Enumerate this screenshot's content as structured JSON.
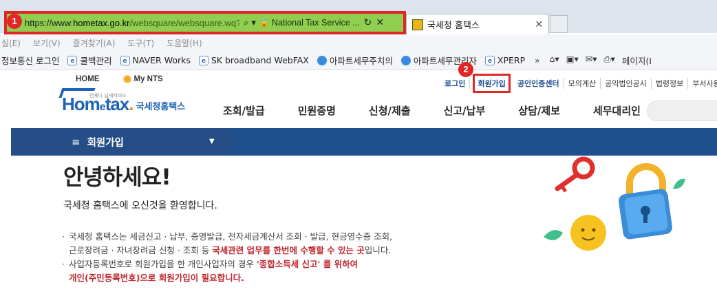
{
  "browser": {
    "badge1": "1",
    "badge2": "2",
    "url_prefix": "https://www.",
    "url_host": "hometax.go.kr",
    "url_path": "/websquare/websquare.wq?w",
    "site_identity": "National Tax Service ...",
    "tab_title": "국세청 홈택스",
    "menu": [
      "실(E)",
      "보기(V)",
      "즐겨찾기(A)",
      "도구(T)",
      "도움말(H)"
    ],
    "favorites": [
      {
        "label": "정보통신 로그인",
        "icon": "none"
      },
      {
        "label": "쿨백관리",
        "icon": "ie"
      },
      {
        "label": "NAVER Works",
        "icon": "ie"
      },
      {
        "label": "SK broadband WebFAX",
        "icon": "ie"
      },
      {
        "label": "아파트세무주치의",
        "icon": "globe"
      },
      {
        "label": "아파트세무관리자",
        "icon": "globe"
      },
      {
        "label": "XPERP",
        "icon": "ie"
      }
    ],
    "fav_tools_page": "페이지(I"
  },
  "site": {
    "util": {
      "home": "HOME",
      "my_nts": "My NTS",
      "links": [
        "로그인",
        "회원가입",
        "공인인증센터",
        "모의계산",
        "공익법인공시",
        "법령정보",
        "부서사용자"
      ]
    },
    "logo": {
      "tag": "언제나 납세서비스",
      "mark_a": "Hom",
      "mark_e": "e",
      "mark_b": "tax",
      "mark_dot": ".",
      "korean": "국세청홈택스"
    },
    "gnb": [
      "조회/발급",
      "민원증명",
      "신청/제출",
      "신고/납부",
      "상담/제보",
      "세무대리인"
    ],
    "breadcrumb_menu_icon": "≡",
    "breadcrumb_title": "회원가입",
    "greeting": "안녕하세요!",
    "welcome": "국세청 홈택스에 오신것을 환영합니다.",
    "note1_a": "국세청 홈택스는 세금신고 · 납부, 증명발급, 전자세금계산서 조회 · 발급, 현금영수증 조회,",
    "note1_b": "근로장려금 · 자녀장려금 신청 · 조회 등 ",
    "note1_hl": "국세관련 업무를 한번에 수행할 수 있는 곳",
    "note1_c": "입니다.",
    "note2_a": "사업자등록번호로 회원가입을 한 개인사업자의 경우 ",
    "note2_hl1": "'종합소득세 신고' 를 위하여",
    "note2_hl2": "개인(주민등록번호)으로 회원가입이 필요합니다."
  },
  "colors": {
    "highlight_red": "#e02626",
    "address_green": "#8fce4f",
    "nav_blue": "#1e4f8f",
    "logo_blue": "#1d63b8",
    "emphasis_red": "#c0262d"
  }
}
